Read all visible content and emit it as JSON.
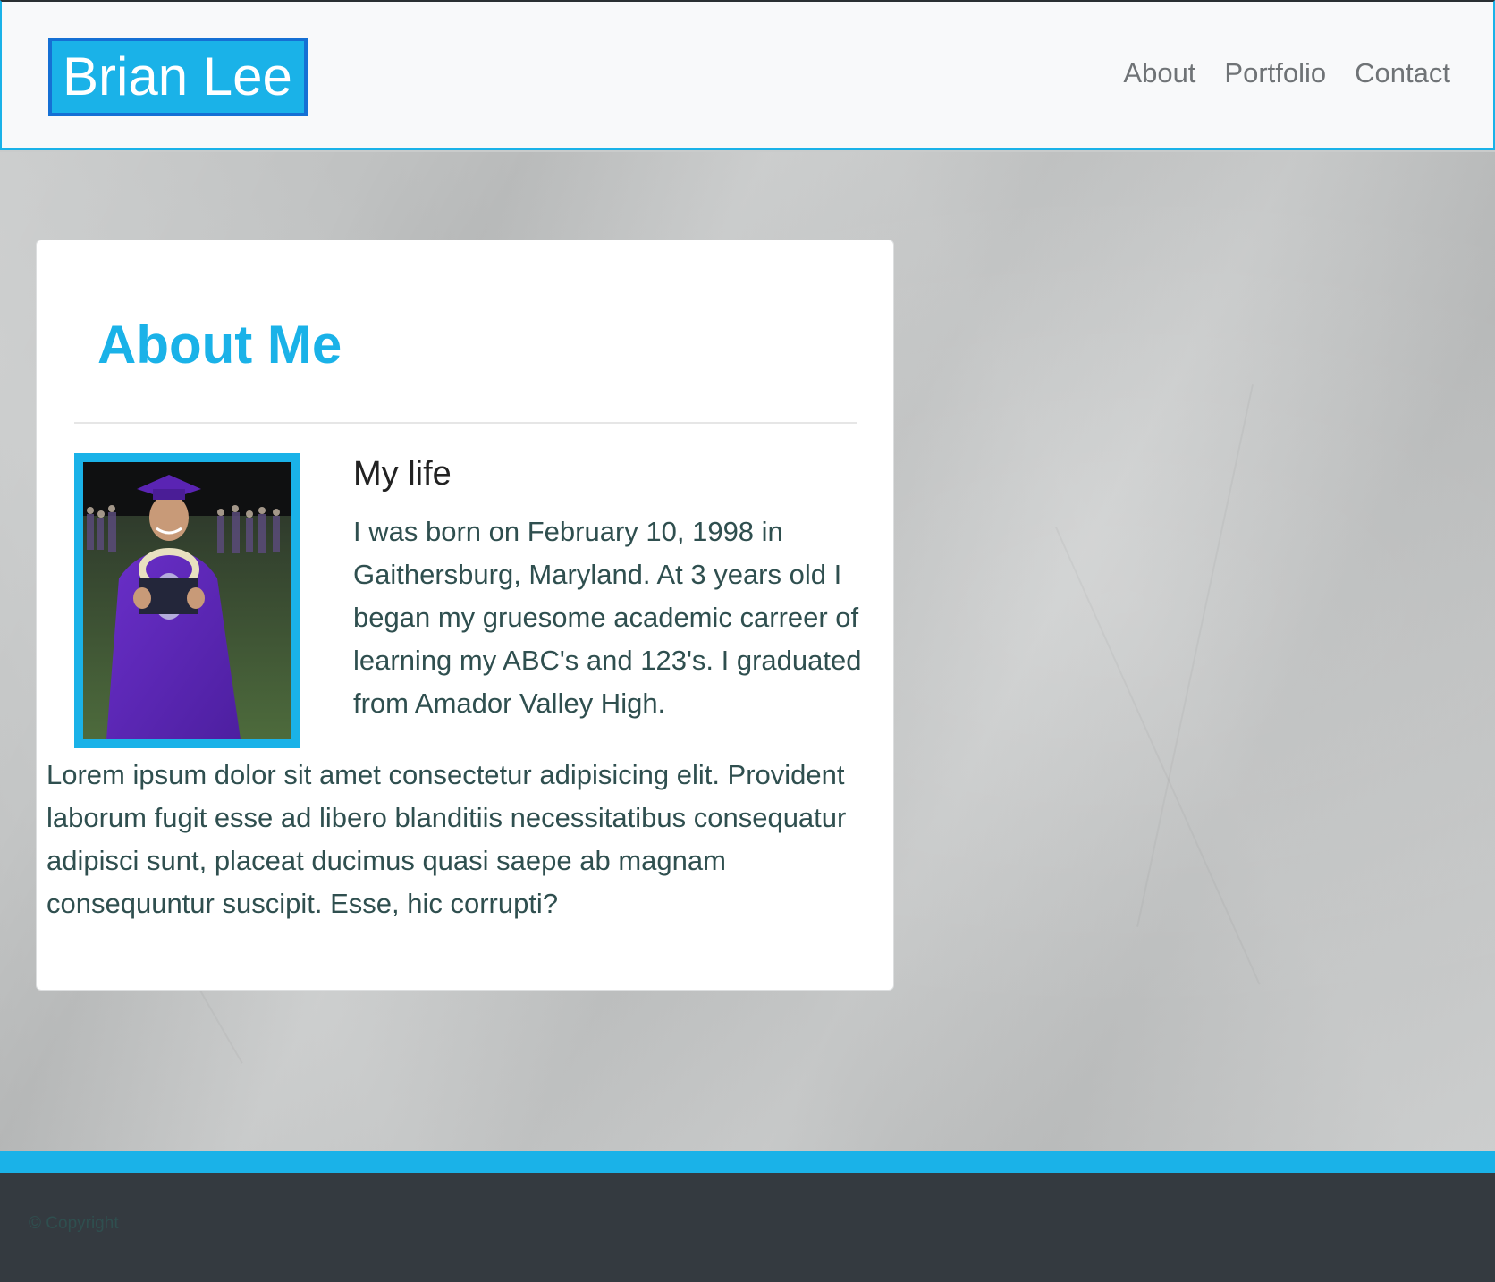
{
  "navbar": {
    "brand": "Brian Lee",
    "links": [
      "About",
      "Portfolio",
      "Contact"
    ]
  },
  "about": {
    "title": "About Me",
    "section_heading": "My life",
    "bio": "I was born on February 10, 1998 in Gaithersburg, Maryland. At 3 years old I began my gruesome academic carreer of learning my ABC's and 123's. I graduated from Amador Valley High.",
    "lorem": "Lorem ipsum dolor sit amet consectetur adipisicing elit. Provident laborum fugit esse ad libero blanditiis necessitatibus consequatur adipisci sunt, placeat ducimus quasi saepe ab magnam consequuntur suscipit. Esse, hic corrupti?"
  },
  "footer": {
    "copyright": "© Copyright"
  },
  "colors": {
    "accent": "#1ab2e8",
    "brand_border": "#1570d4",
    "footer_bg": "#343a40",
    "text": "#2f4f4f"
  }
}
